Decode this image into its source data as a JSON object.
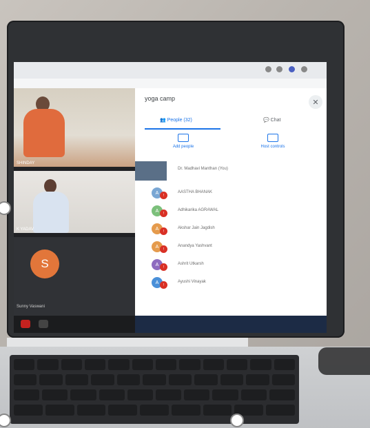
{
  "meeting": {
    "title": "yoga camp",
    "close_icon": "close-icon"
  },
  "panel": {
    "tabs": [
      {
        "label": "People (32)"
      },
      {
        "label": "Chat"
      }
    ],
    "actions": [
      {
        "label": "Add people"
      },
      {
        "label": "Host controls"
      }
    ],
    "people": [
      {
        "name": "Dr. Madhavi Manthan (You)",
        "kind": "video"
      },
      {
        "name": "AASTHA BHANAK",
        "initial": "A",
        "color": "#7aa7d4"
      },
      {
        "name": "Adhikarika AGRAWAL",
        "initial": "A",
        "color": "#7cc07b"
      },
      {
        "name": "Akshar Jain Jagdish",
        "initial": "A",
        "color": "#e59b4d"
      },
      {
        "name": "Anandya Yashvant",
        "initial": "A",
        "color": "#e59b4d"
      },
      {
        "name": "Ashrit Utkarsh",
        "initial": "A",
        "color": "#8e6bbf"
      },
      {
        "name": "Ayushi Vinayak",
        "initial": "A",
        "color": "#4a90d9"
      }
    ]
  },
  "videos": {
    "tiles": [
      {
        "name": "SHINDAY"
      },
      {
        "name": "K YADAV"
      },
      {
        "name": "Sunny Vaswani",
        "initial": "S"
      }
    ]
  }
}
